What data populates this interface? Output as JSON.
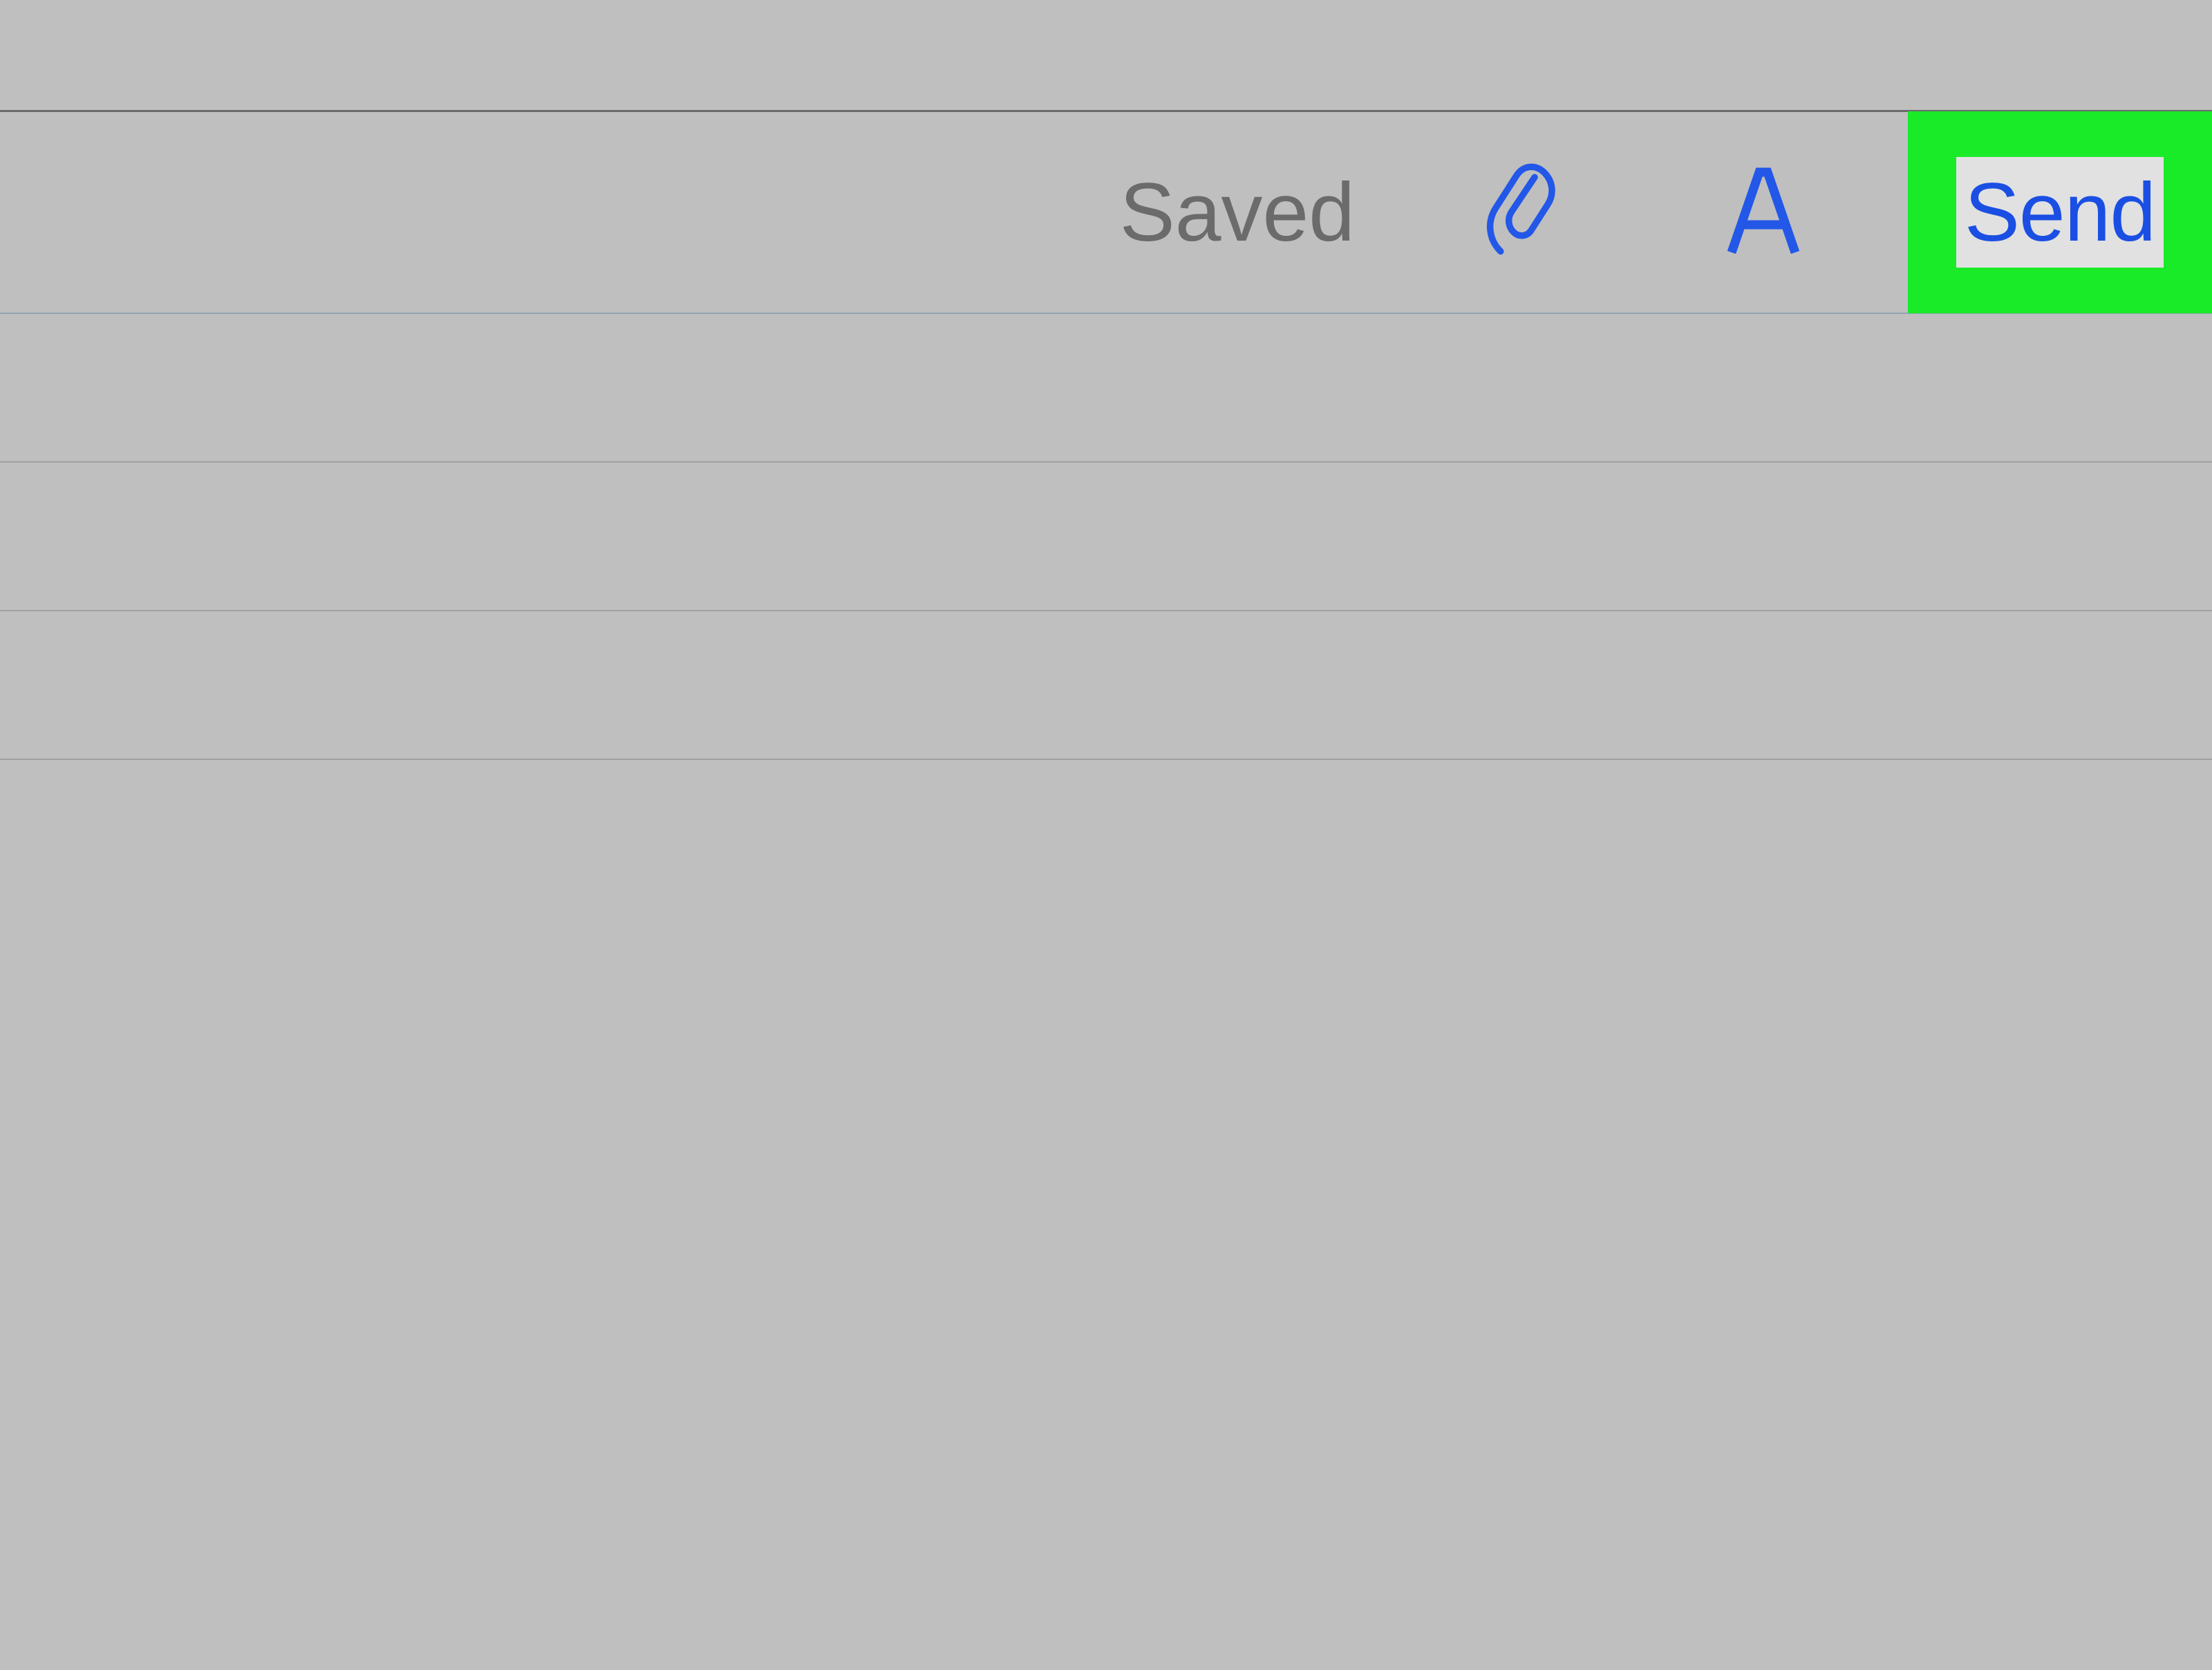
{
  "toolbar": {
    "status_label": "Saved",
    "send_label": "Send",
    "icons": {
      "attachment": "paperclip-icon",
      "format": "font-icon"
    }
  },
  "colors": {
    "accent": "#1b4fe3",
    "highlight": "#1aeb29",
    "muted_text": "#6b6b6b",
    "background": "#bfbfc0"
  }
}
